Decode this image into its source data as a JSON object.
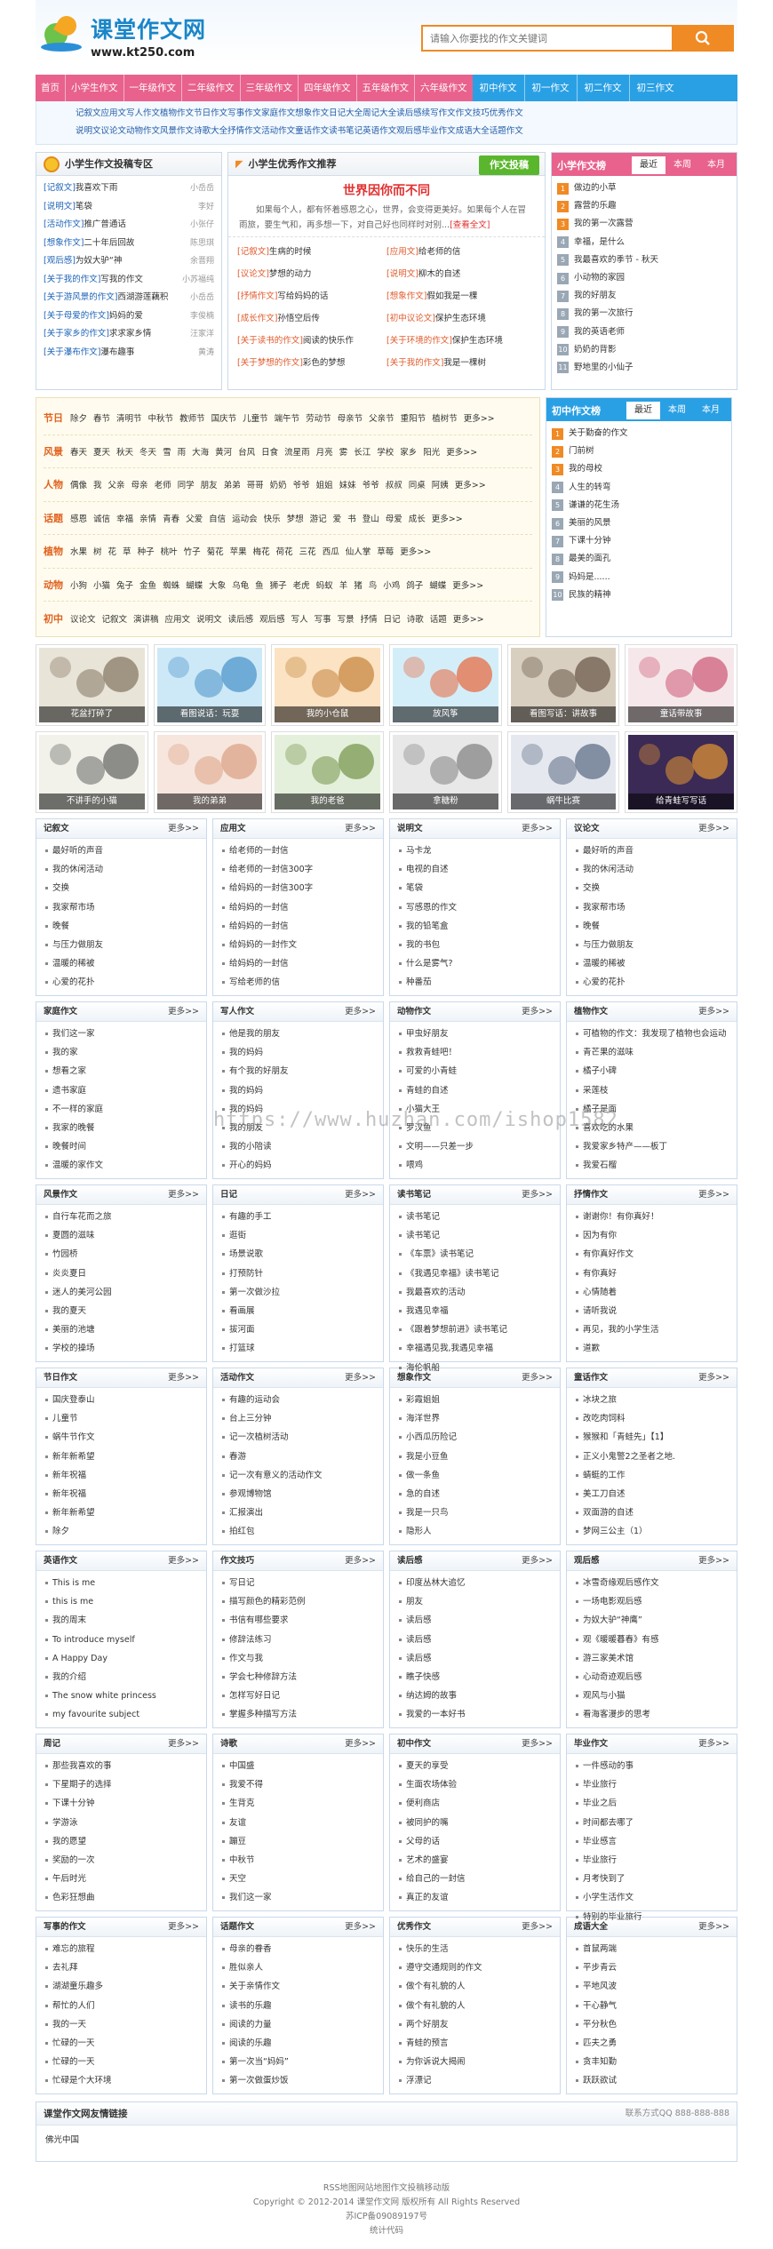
{
  "header": {
    "logo_title": "课堂作文网",
    "logo_url": "www.kt250.com",
    "search_placeholder": "请输入你要找的作文关键词"
  },
  "nav": {
    "pink": [
      "首页",
      "小学生作文",
      "一年级作文",
      "二年级作文",
      "三年级作文",
      "四年级作文",
      "五年级作文",
      "六年级作文"
    ],
    "blue": [
      "初中作文",
      "初一作文",
      "初二作文",
      "初三作文"
    ]
  },
  "subnav": [
    [
      "记叙文",
      "应用文",
      "写人作文",
      "植物作文",
      "节日作文",
      "写事作文",
      "家庭作文",
      "想象作文",
      "日记大全",
      "周记大全",
      "读后感",
      "续写作文",
      "作文技巧",
      "优秀作文"
    ],
    [
      "说明文",
      "议论文",
      "动物作文",
      "风景作文",
      "诗歌大全",
      "抒情作文",
      "活动作文",
      "童话作文",
      "读书笔记",
      "英语作文",
      "观后感",
      "毕业作文",
      "成语大全",
      "话题作文"
    ]
  ],
  "submit": {
    "title": "小学生作文投稿专区",
    "items": [
      {
        "tag": "[记叙文]",
        "t": "我喜欢下雨",
        "a": "小岳岳"
      },
      {
        "tag": "[说明文]",
        "t": "笔袋",
        "a": "李好"
      },
      {
        "tag": "[活动作文]",
        "t": "推广普通话",
        "a": "小张仔"
      },
      {
        "tag": "[想象作文]",
        "t": "二十年后回故",
        "a": "陈思琪"
      },
      {
        "tag": "[观后感]",
        "t": "为奴大驴“神",
        "a": "余晋翔"
      },
      {
        "tag": "[关于我的作文]",
        "t": "写我的作文",
        "a": "小苏福纯"
      },
      {
        "tag": "[关于游风景的作文]",
        "t": "西湖游莲藕积",
        "a": "小岳岳"
      },
      {
        "tag": "[关于母爱的作文]",
        "t": "妈妈的爱",
        "a": "李俊楠"
      },
      {
        "tag": "[关于家乡的作文]",
        "t": "求求家乡情",
        "a": "汪家洋"
      },
      {
        "tag": "[关于瀑布作文]",
        "t": "瀑布趣事",
        "a": "黄涛"
      }
    ]
  },
  "featured": {
    "title": "小学生优秀作文推荐",
    "button": "作文投稿",
    "head": "世界因你而不同",
    "summary": "如果每个人，都有怀着感恩之心，世界，会变得更美好。如果每个人在冒雨旅，要生气和，再多想一下，对自己好也同样时对别...",
    "more": "[查看全文]",
    "items": [
      {
        "tag": "[记叙文]",
        "t": "生病的时候"
      },
      {
        "tag": "[应用文]",
        "t": "给老师的信"
      },
      {
        "tag": "[议论文]",
        "t": "梦想的动力"
      },
      {
        "tag": "[说明文]",
        "t": "柳木的自述"
      },
      {
        "tag": "[抒情作文]",
        "t": "写给妈妈的话"
      },
      {
        "tag": "[想象作文]",
        "t": "假如我是一棵"
      },
      {
        "tag": "[成长作文]",
        "t": "孙悟空后传"
      },
      {
        "tag": "[初中议论文]",
        "t": "保护生态环境"
      },
      {
        "tag": "[关于读书的作文]",
        "t": "阅读的快乐作"
      },
      {
        "tag": "[关于环境的作文]",
        "t": "保护生态环境"
      },
      {
        "tag": "[关于梦想的作文]",
        "t": "彩色的梦想"
      },
      {
        "tag": "[关于我的作文]",
        "t": "我是一棵树"
      }
    ]
  },
  "rank_primary": {
    "title": "小学作文榜",
    "tabs": [
      "最近",
      "本周",
      "本月"
    ],
    "items": [
      "做边的小草",
      "露营的乐趣",
      "我的第一次露营",
      "幸福，是什么",
      "我最喜欢的季节 - 秋天",
      "小动物的家园",
      "我的好朋友",
      "我的第一次旅行",
      "我的英语老师",
      "奶奶的背影",
      "野地里的小仙子"
    ]
  },
  "rank_middle": {
    "title": "初中作文榜",
    "tabs": [
      "最近",
      "本周",
      "本月"
    ],
    "items": [
      "关于勤奋的作文",
      "门前树",
      "我的母校",
      "人生的转弯",
      "谦谦的花生汤",
      "美丽的风景",
      "下课十分钟",
      "最美的面孔",
      "妈妈是......",
      "民族的精神"
    ]
  },
  "tags": [
    {
      "label": "节日",
      "words": [
        "除夕",
        "春节",
        "清明节",
        "中秋节",
        "教师节",
        "国庆节",
        "儿童节",
        "端午节",
        "劳动节",
        "母亲节",
        "父亲节",
        "重阳节",
        "植树节",
        "更多>>"
      ]
    },
    {
      "label": "风景",
      "words": [
        "春天",
        "夏天",
        "秋天",
        "冬天",
        "雪",
        "雨",
        "大海",
        "黄河",
        "台风",
        "日食",
        "流星雨",
        "月亮",
        "雾",
        "长江",
        "学校",
        "家乡",
        "阳光",
        "更多>>"
      ]
    },
    {
      "label": "人物",
      "words": [
        "偶像",
        "我",
        "父亲",
        "母亲",
        "老师",
        "同学",
        "朋友",
        "弟弟",
        "哥哥",
        "奶奶",
        "爷爷",
        "姐姐",
        "妹妹",
        "爷爷",
        "叔叔",
        "同桌",
        "阿姨",
        "更多>>"
      ]
    },
    {
      "label": "话题",
      "words": [
        "感恩",
        "诚信",
        "幸福",
        "亲情",
        "青春",
        "父爱",
        "自信",
        "运动会",
        "快乐",
        "梦想",
        "游记",
        "爱",
        "书",
        "登山",
        "母爱",
        "成长",
        "更多>>"
      ]
    },
    {
      "label": "植物",
      "words": [
        "水果",
        "树",
        "花",
        "草",
        "种子",
        "桃叶",
        "竹子",
        "菊花",
        "苹果",
        "梅花",
        "荷花",
        "三花",
        "西瓜",
        "仙人掌",
        "草莓",
        "更多>>"
      ]
    },
    {
      "label": "动物",
      "words": [
        "小狗",
        "小猫",
        "兔子",
        "金鱼",
        "蜘蛛",
        "蝴蝶",
        "大象",
        "乌龟",
        "鱼",
        "狮子",
        "老虎",
        "蚂蚁",
        "羊",
        "猪",
        "鸟",
        "小鸡",
        "鸽子",
        "蝴蝶",
        "更多>>"
      ]
    },
    {
      "label": "初中",
      "words": [
        "议论文",
        "记叙文",
        "演讲稿",
        "应用文",
        "说明文",
        "读后感",
        "观后感",
        "写人",
        "写事",
        "写景",
        "抒情",
        "日记",
        "诗歌",
        "话题",
        "更多>>"
      ]
    }
  ],
  "pictures": [
    "花盆打碎了",
    "看图说话：玩耍",
    "我的小仓鼠",
    "放风筝",
    "看图写话：讲故事",
    "童话带故事",
    "不讲手的小猫",
    "我的弟弟",
    "我的老爸",
    "拿糖粉",
    "蜗牛比赛",
    "给青蛙写写话"
  ],
  "categories": [
    {
      "title": "记叙文",
      "items": [
        "最好听的声音",
        "我的休闲活动",
        "交换",
        "我家帮市场",
        "晚餐",
        "与压力做朋友",
        "温暖的稀被",
        "心爱的花扑"
      ]
    },
    {
      "title": "应用文",
      "items": [
        "给老师的一封信",
        "给老师的一封信300字",
        "给妈妈的一封信300字",
        "给妈妈的一封信",
        "给妈妈的一封信",
        "给妈妈的一封作文",
        "给妈妈的一封信",
        "写给老师的信"
      ]
    },
    {
      "title": "说明文",
      "items": [
        "马卡龙",
        "电视的自述",
        "笔袋",
        "写感恩的作文",
        "我的铅笔盒",
        "我的书包",
        "什么是雾气?",
        "种番茄"
      ]
    },
    {
      "title": "议论文",
      "items": [
        "最好听的声音",
        "我的休闲活动",
        "交换",
        "我家帮市场",
        "晚餐",
        "与压力做朋友",
        "温暖的稀被",
        "心爱的花扑"
      ]
    },
    {
      "title": "家庭作文",
      "items": [
        "我们这一家",
        "我的家",
        "想看之家",
        "遗书家庭",
        "不一样的家庭",
        "我家的晚餐",
        "晚餐时间",
        "温暖的家作文"
      ]
    },
    {
      "title": "写人作文",
      "items": [
        "他是我的朋友",
        "我的妈妈",
        "有个我的好朋友",
        "我的妈妈",
        "我的妈妈",
        "我的朋友",
        "我的小陪读",
        "开心的妈妈"
      ]
    },
    {
      "title": "动物作文",
      "items": [
        "甲虫好朋友",
        "救救青蛙吧！",
        "可爱的小青蛙",
        "青蛙的自述",
        "小猫大王",
        "罗汉鱼",
        "文明——只差一步",
        "喂鸡"
      ]
    },
    {
      "title": "植物作文",
      "items": [
        "可植物的作文：我发现了植物也会运动",
        "青芒果的滋味",
        "橘子小碑",
        "采莲枝",
        "橘子是面",
        "喜欢吃的水果",
        "我爱家乡特产——板丁",
        "我爱石榴"
      ]
    },
    {
      "title": "风景作文",
      "items": [
        "自行车花而之旅",
        "夏圆的滋味",
        "竹园桥",
        "炎炎夏日",
        "迷人的美河公园",
        "我的夏天",
        "美丽的池塘",
        "学校的操场"
      ]
    },
    {
      "title": "日记",
      "items": [
        "有趣的手工",
        "逛街",
        "场景说歌",
        "打预防针",
        "第一次做沙拉",
        "看画展",
        "拔河面",
        "打篮球"
      ]
    },
    {
      "title": "读书笔记",
      "items": [
        "读书笔记",
        "读书笔记",
        "《车票》读书笔记",
        "《我遇见幸福》读书笔记",
        "我最喜欢的活动",
        "我遇见幸福",
        "《跟着梦想前进》读书笔记",
        "幸福遇见我,我遇见幸福",
        "海伦帆船"
      ]
    },
    {
      "title": "抒情作文",
      "items": [
        "谢谢你！有你真好！",
        "因为有你",
        "有你真好作文",
        "有你真好",
        "心情随着",
        "请听我说",
        "再见，我的小学生活",
        "道歉"
      ]
    },
    {
      "title": "节日作文",
      "items": [
        "国庆登泰山",
        "儿童节",
        "蜗牛节作文",
        "新年新希望",
        "新年祝福",
        "新年祝福",
        "新年新希望",
        "除夕"
      ]
    },
    {
      "title": "活动作文",
      "items": [
        "有趣的运动会",
        "台上三分钟",
        "记一次植树活动",
        "春游",
        "记一次有意义的活动作文",
        "参观博物馆",
        "汇报演出",
        "拍红包"
      ]
    },
    {
      "title": "想象作文",
      "items": [
        "彩霞姐姐",
        "海洋世界",
        "小西瓜历险记",
        "我是小豆鱼",
        "做一条鱼",
        "急的自述",
        "我是一只鸟",
        "隐形人"
      ]
    },
    {
      "title": "童话作文",
      "items": [
        "冰块之旅",
        "改吃肉饲料",
        "猴猴和「青蛙先」【1】",
        "正义小鬼警2之圣者之地.",
        "蜻蜓的工作",
        "美工刀自述",
        "双面游的自述",
        "梦网三公主（1）"
      ]
    },
    {
      "title": "英语作文",
      "items": [
        "This is me",
        "this is me",
        "我的周末",
        "To introduce myself",
        "A Happy Day",
        "我的介绍",
        "The snow white princess",
        "my favourite subject"
      ]
    },
    {
      "title": "作文技巧",
      "items": [
        "写日记",
        "描写颜色的精彩范例",
        "书信有哪些要求",
        "修辞法练习",
        "作文与我",
        "学会七种修辞方法",
        "怎样写好日记",
        "掌握多种描写方法"
      ]
    },
    {
      "title": "读后感",
      "items": [
        "印度丛林大追忆",
        "朋友",
        "读后感",
        "读后感",
        "读后感",
        "瞧子快感",
        "纳达姆的故事",
        "我爱的一本好书"
      ]
    },
    {
      "title": "观后感",
      "items": [
        "冰雪奇缘观后感作文",
        "一场电影观后感",
        "为奴大驴“神鹰”",
        "观《暖暖暮春》有感",
        "游三家美术馆",
        "心动奇迹观后感",
        "观风与小猫",
        "看海客漫步的思考"
      ]
    },
    {
      "title": "周记",
      "items": [
        "那些我喜欢的事",
        "下星期子的选择",
        "下课十分钟",
        "学游泳",
        "我的愿望",
        "奖励的一次",
        "午后时光",
        "色彩狂想曲"
      ]
    },
    {
      "title": "诗歌",
      "items": [
        "中国盛",
        "我爱不得",
        "生背克",
        "友谊",
        "蹦豆",
        "中秋节",
        "天空",
        "我们这一家"
      ]
    },
    {
      "title": "初中作文",
      "items": [
        "夏天的享受",
        "生面农场体验",
        "便利商店",
        "被同护的嘴",
        "父母的话",
        "艺术的盛宴",
        "给自己的一封信",
        "真正的友谊"
      ]
    },
    {
      "title": "毕业作文",
      "items": [
        "一件感动的事",
        "毕业旅行",
        "毕业之后",
        "时间都去哪了",
        "毕业感言",
        "毕业旅行",
        "月考快到了",
        "小学生活作文",
        "特别的毕业旅行"
      ]
    },
    {
      "title": "写事的作文",
      "items": [
        "难忘的旅程",
        "去礼拜",
        "湖湖童乐趣多",
        "帮忙的人们",
        "我的一天",
        "忙碌的一天",
        "忙碌的一天",
        "忙碌是个大环境"
      ]
    },
    {
      "title": "话题作文",
      "items": [
        "母亲的眷香",
        "胜似亲人",
        "关于亲情作文",
        "读书的乐趣",
        "阅读的力量",
        "阅读的乐趣",
        "第一次当“妈妈”",
        "第一次做蛋炒饭"
      ]
    },
    {
      "title": "优秀作文",
      "items": [
        "快乐的生活",
        "遵守交通规则的作文",
        "做个有礼貌的人",
        "做个有礼貌的人",
        "两个好朋友",
        "青蛙的预言",
        "为你诉说大揭闹",
        "浮漂记"
      ]
    },
    {
      "title": "成语大全",
      "items": [
        "首鼠两端",
        "平步青云",
        "平地风波",
        "干心静气",
        "平分秋色",
        "匹夫之勇",
        "贪丰知勤",
        "跃跃欲试"
      ]
    }
  ],
  "more_label": "更多>>",
  "links": {
    "title": "课堂作文网友情链接",
    "contact": "联系方式QQ 888-888-888",
    "items": [
      "佛光中国"
    ]
  },
  "footer": {
    "links": [
      "RSS地图",
      "网站地图",
      "作文投稿",
      "移动版"
    ],
    "copyright": "Copyright © 2012-2014  课堂作文网  版权所有 All Rights Reserved",
    "icp": "苏ICP备09089197号",
    "stats": "统计代码"
  },
  "watermark": "https://www.huzhan.com/ishop1582",
  "colors": {
    "pink": "#e8628d",
    "blue": "#2aa0e4",
    "orange": "#f08a24",
    "green": "#5ab72d"
  }
}
